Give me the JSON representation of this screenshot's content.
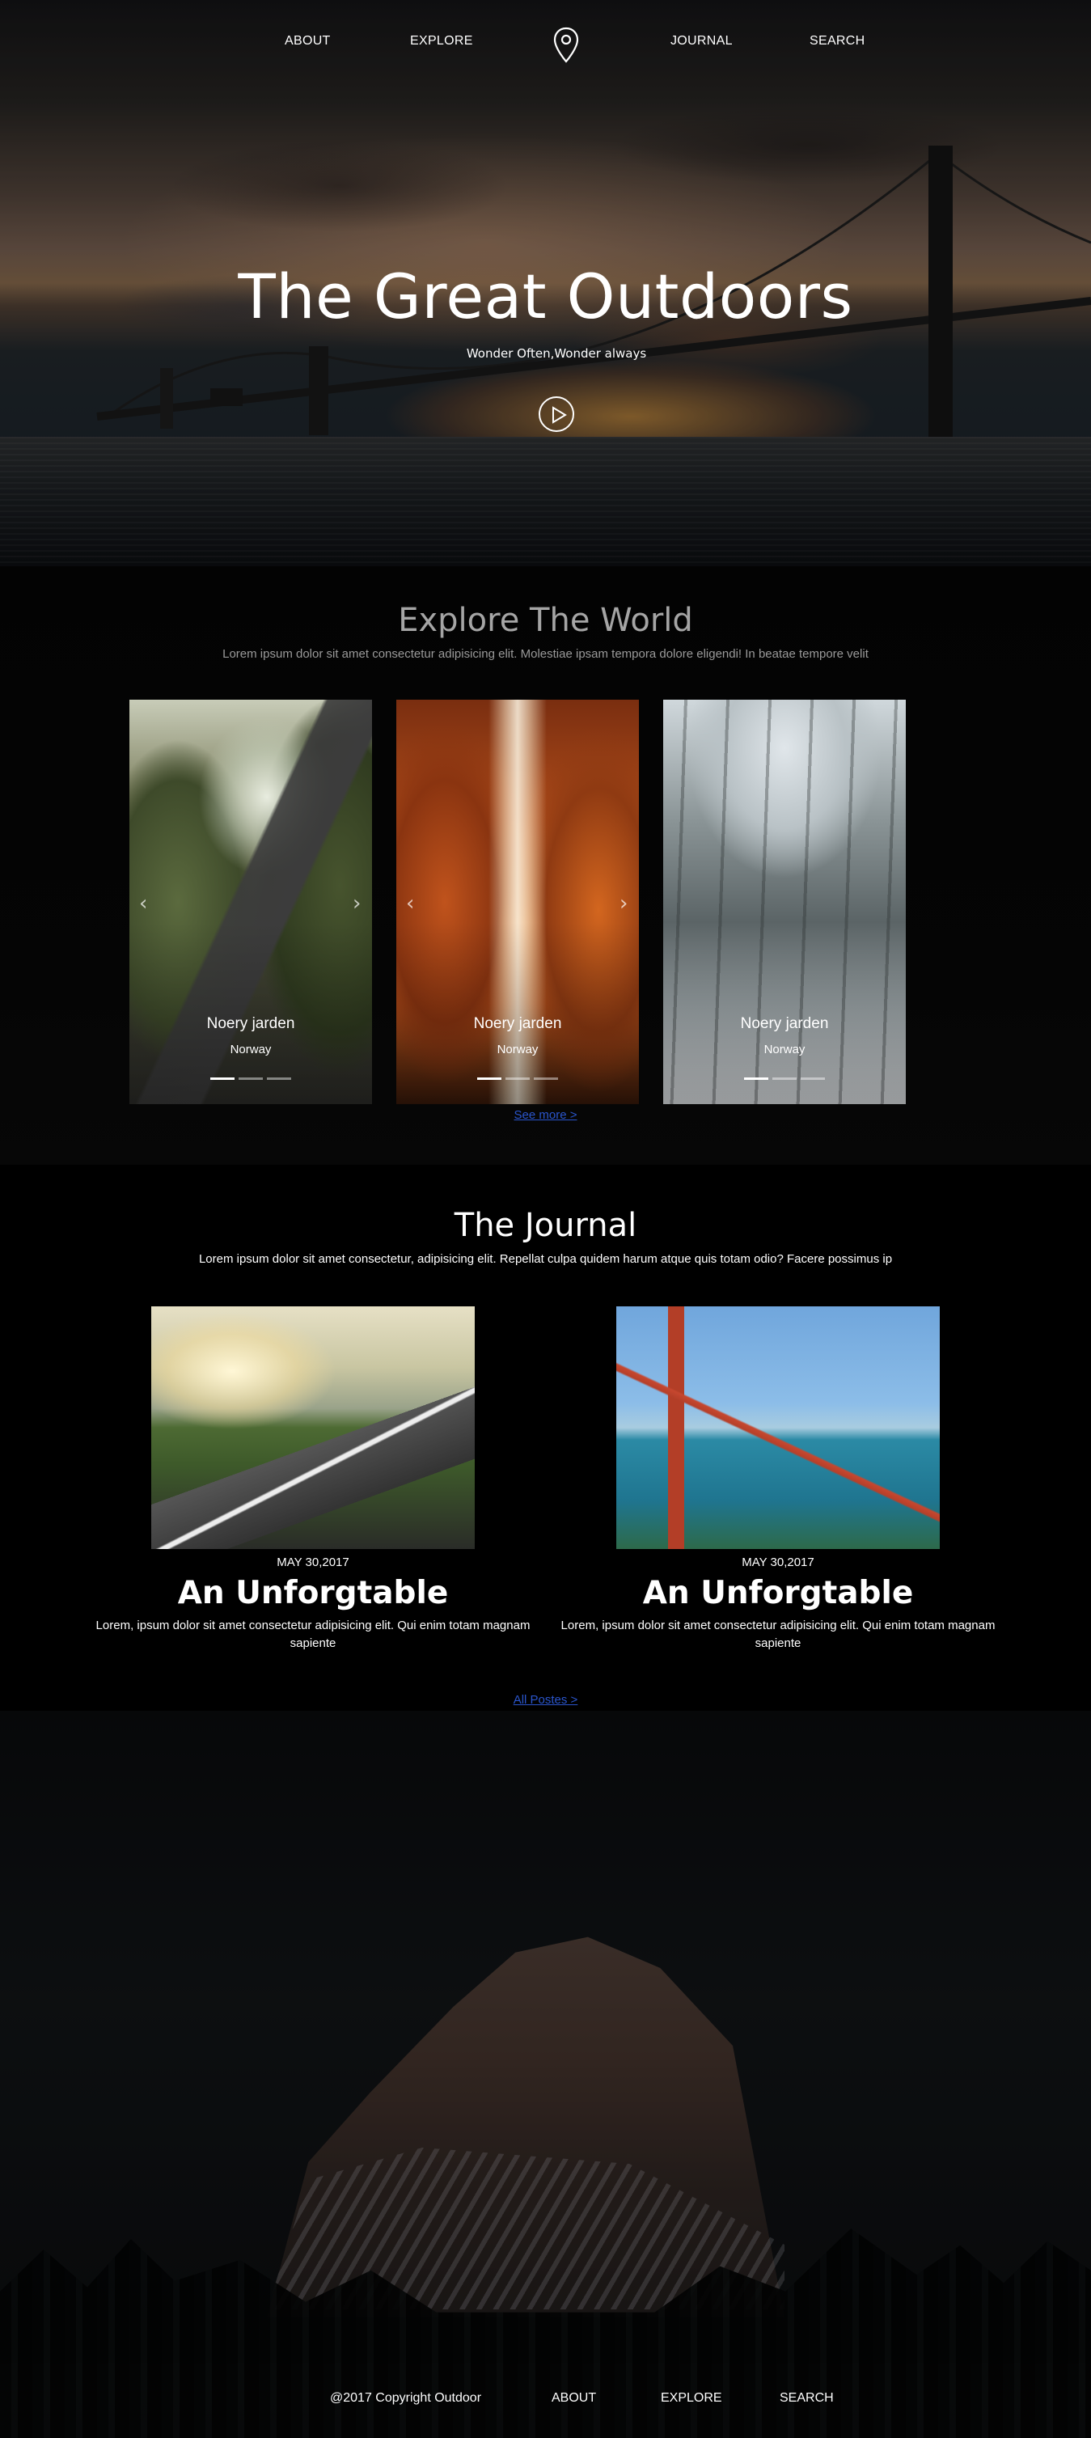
{
  "nav": {
    "about": "ABOUT",
    "explore": "EXPLORE",
    "journal": "JOURNAL",
    "search": "SEARCH",
    "logo_icon": "map-pin-icon"
  },
  "hero": {
    "title": "The Great Outdoors",
    "subtitle": "Wonder Often,Wonder always",
    "play_icon": "play-circle-icon"
  },
  "explore": {
    "title": "Explore The World",
    "description": "Lorem ipsum dolor sit amet consectetur adipisicing elit. Molestiae ipsam tempora dolore eligendi! In beatae tempore velit",
    "cards": [
      {
        "title": "Noery jarden",
        "subtitle": "Norway"
      },
      {
        "title": "Noery jarden",
        "subtitle": "Norway"
      },
      {
        "title": "Noery jarden",
        "subtitle": "Norway"
      }
    ],
    "see_more": "See more >"
  },
  "journal": {
    "title": "The Journal",
    "description": "Lorem ipsum dolor sit amet consectetur, adipisicing elit. Repellat culpa quidem harum atque quis totam odio? Facere possimus ip",
    "posts": [
      {
        "date": "MAY 30,2017",
        "title": "An Unforgtable",
        "body": "Lorem, ipsum dolor sit amet consectetur adipisicing elit. Qui enim totam magnam sapiente"
      },
      {
        "date": "MAY 30,2017",
        "title": "An Unforgtable",
        "body": "Lorem, ipsum dolor sit amet consectetur adipisicing elit. Qui enim totam magnam sapiente"
      }
    ],
    "all_posts": "All Postes >"
  },
  "footer": {
    "copyright": "@2017 Copyright Outdoor",
    "about": "ABOUT",
    "explore": "EXPLORE",
    "search": "SEARCH"
  }
}
